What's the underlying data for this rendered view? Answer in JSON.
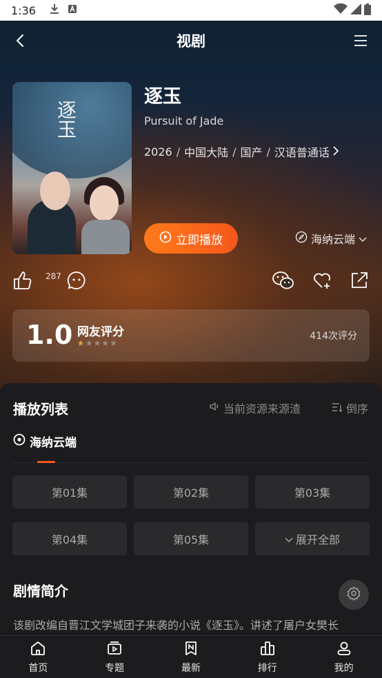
{
  "status_bar": {
    "time": "1:36"
  },
  "header": {
    "title": "视剧"
  },
  "show": {
    "title_cn": "逐玉",
    "title_en": "Pursuit of Jade",
    "poster_text": "逐玉",
    "meta": [
      "2026",
      "中国大陆",
      "国产",
      "汉语普通话"
    ],
    "meta_separator": "/"
  },
  "play_button": {
    "label": "立即播放"
  },
  "source_select": {
    "value": "海纳云端"
  },
  "actions": {
    "like_count": "287"
  },
  "rating": {
    "score": "1.0",
    "label": "网友评分",
    "count": "414次评分",
    "stars_filled": 0.5,
    "stars_total": 5
  },
  "playlist": {
    "title": "播放列表",
    "source_note": "当前资源来源渣",
    "order_label": "倒序",
    "source_tab": "海纳云端",
    "episodes": [
      "第01集",
      "第02集",
      "第03集",
      "第04集",
      "第05集"
    ],
    "expand_label": "展开全部"
  },
  "synopsis": {
    "title": "剧情简介",
    "text": "该剧改编自晋江文学城团子来袭的小说《逐玉》。讲述了屠户女樊长"
  },
  "bottom_nav": [
    "首页",
    "专题",
    "最新",
    "排行",
    "我的"
  ],
  "colors": {
    "accent": "#f4581b",
    "star": "#ffb21a"
  }
}
